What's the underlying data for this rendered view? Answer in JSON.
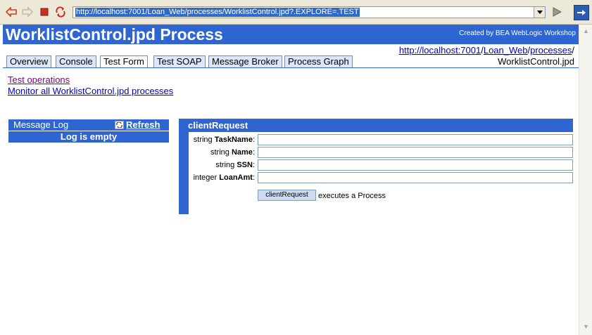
{
  "browser": {
    "url": "http://localhost:7001/Loan_Web/processes/WorklistControl.jpd?.EXPLORE=.TEST",
    "icons": [
      "back-arrow-icon",
      "forward-arrow-icon",
      "stop-icon",
      "refresh-icon",
      "go-icon",
      "exit-icon"
    ]
  },
  "banner": {
    "title": "WorklistControl.jpd Process",
    "credit": "Created by BEA WebLogic Workshop"
  },
  "tabs": [
    {
      "label": "Overview"
    },
    {
      "label": "Console"
    },
    {
      "label": "Test Form",
      "active": true
    },
    {
      "label": "Test SOAP"
    },
    {
      "label": "Message Broker"
    },
    {
      "label": "Process Graph"
    }
  ],
  "breadcrumb": {
    "host": "http://localhost:7001",
    "sep": "/",
    "webapp": "Loan_Web",
    "folder": "processes",
    "file": "WorklistControl.jpd"
  },
  "links": {
    "test_operations": "Test operations",
    "monitor_all": "Monitor all WorklistControl.jpd processes"
  },
  "message_log": {
    "title": "Message Log",
    "refresh": "Refresh",
    "empty_text": "Log is empty"
  },
  "client_request": {
    "title": "clientRequest",
    "fields": [
      {
        "type": "string",
        "name": "TaskName",
        "value": ""
      },
      {
        "type": "string",
        "name": "Name",
        "value": ""
      },
      {
        "type": "string",
        "name": "SSN",
        "value": ""
      },
      {
        "type": "integer",
        "name": "LoanAmt",
        "value": ""
      }
    ],
    "button_label": "clientRequest",
    "note": "executes a Process"
  },
  "colors": {
    "banner": "#2f65d1",
    "link": "#0000cc",
    "visited_link": "#800080",
    "toolbar": "#ece9d8"
  }
}
